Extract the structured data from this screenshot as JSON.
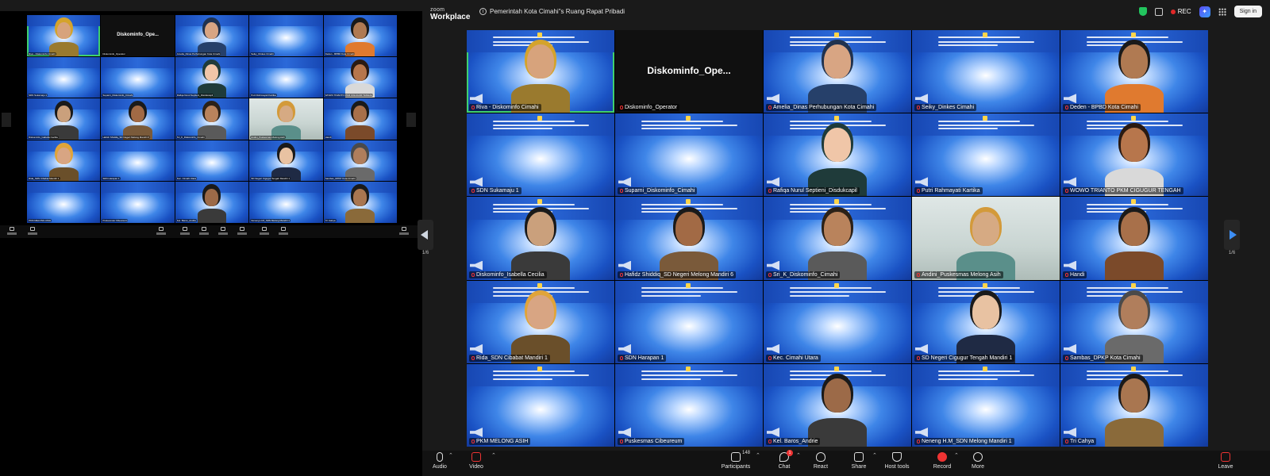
{
  "titlebar": {
    "logo_top": "zoom",
    "logo_bottom": "Workplace",
    "meeting_title": "Pemerintah Kota Cimahi\"s Ruang Rapat Pribadi",
    "rec_label": "REC",
    "signin_label": "Sign in"
  },
  "pager": {
    "left_label": "1/6",
    "right_label": "1/6"
  },
  "tiles": [
    {
      "name": "Riva - Diskominfo Cimahi",
      "kind": "person",
      "active": true,
      "skin": "#d7a37c",
      "hair": "#d4a32c",
      "shirt": "#9a7a2e"
    },
    {
      "name": "Diskominfo_Operator",
      "kind": "dark",
      "center": "Diskominfo_Ope..."
    },
    {
      "name": "Amelia_Dinas Perhubungan Kota Cimahi",
      "kind": "person",
      "skin": "#d8a583",
      "hair": "#20324f",
      "shirt": "#26406a"
    },
    {
      "name": "Seiky_Dinkes Cimahi",
      "kind": "bg"
    },
    {
      "name": "Deden - BPBD Kota Cimahi",
      "kind": "person",
      "skin": "#b07a52",
      "hair": "#1a1a1a",
      "shirt": "#e07a2f"
    },
    {
      "name": "SDN Sukamaju 1",
      "kind": "bg"
    },
    {
      "name": "Suparni_Diskominfo_Cimahi",
      "kind": "bg"
    },
    {
      "name": "Rafiqa Nurul Septieni_Disdukcapil",
      "kind": "person",
      "skin": "#f0c6a8",
      "hair": "#1f3b3a",
      "shirt": "#1f3b3a"
    },
    {
      "name": "Putri Rahmayati Kartika",
      "kind": "bg"
    },
    {
      "name": "WOWO TRIANTO PKM CIGUGUR TENGAH",
      "kind": "person",
      "skin": "#b7764c",
      "hair": "#2a1a12",
      "shirt": "#d9d9d9"
    },
    {
      "name": "Diskominfo_Isabella Cecilia",
      "kind": "person",
      "skin": "#caa07c",
      "hair": "#1a1a1a",
      "shirt": "#3a3a3a"
    },
    {
      "name": "Hafidz Shiddiq_SD Negeri Melong Mandiri 6",
      "kind": "person",
      "skin": "#a26a45",
      "hair": "#1a1a1a",
      "shirt": "#7a5a3a"
    },
    {
      "name": "Sri_K_Diskominfo_Cimahi",
      "kind": "person",
      "skin": "#b9835c",
      "hair": "#2b2118",
      "shirt": "#5a5a5a"
    },
    {
      "name": "Andini_Puskesmas Melong Asih",
      "kind": "photo",
      "skin": "#d6aa83",
      "hair": "#d39a3a",
      "shirt": "#5a8f8a"
    },
    {
      "name": "Handi",
      "kind": "person",
      "skin": "#a8704a",
      "hair": "#1a1a1a",
      "shirt": "#7b4a2a"
    },
    {
      "name": "Rida_SDN Cibabat Mandiri 1",
      "kind": "person",
      "skin": "#d8a583",
      "hair": "#e0a43a",
      "shirt": "#6a4f2a"
    },
    {
      "name": "SDN Harapan 1",
      "kind": "bg"
    },
    {
      "name": "Kec. Cimahi Utara",
      "kind": "bg"
    },
    {
      "name": "SD Negeri Cigugur Tengah Mandiri 1",
      "kind": "person",
      "skin": "#e8c2a2",
      "hair": "#1a1a1a",
      "shirt": "#1f2a44"
    },
    {
      "name": "Sambas_DPKP Kota Cimahi",
      "kind": "person",
      "skin": "#b07e5c",
      "hair": "#4a4a4a",
      "shirt": "#6a6a6a"
    },
    {
      "name": "PKM MELONG ASIH",
      "kind": "bg"
    },
    {
      "name": "Puskesmas Cibeureum",
      "kind": "bg"
    },
    {
      "name": "Kel. Baros_Andrie",
      "kind": "person",
      "skin": "#9c6a48",
      "hair": "#1a1a1a",
      "shirt": "#3a3a3a"
    },
    {
      "name": "Neneng H.M_SDN Melong Mandiri 1",
      "kind": "bg"
    },
    {
      "name": "Tri Cahya",
      "kind": "person",
      "skin": "#a97650",
      "hair": "#1a1a1a",
      "shirt": "#8a6a3a"
    }
  ],
  "toolbar": {
    "audio": "Audio",
    "video": "Video",
    "participants": "Participants",
    "participants_count": "148",
    "chat": "Chat",
    "chat_badge": "1",
    "react": "React",
    "share": "Share",
    "host_tools": "Host tools",
    "record": "Record",
    "more": "More",
    "leave": "Leave"
  }
}
